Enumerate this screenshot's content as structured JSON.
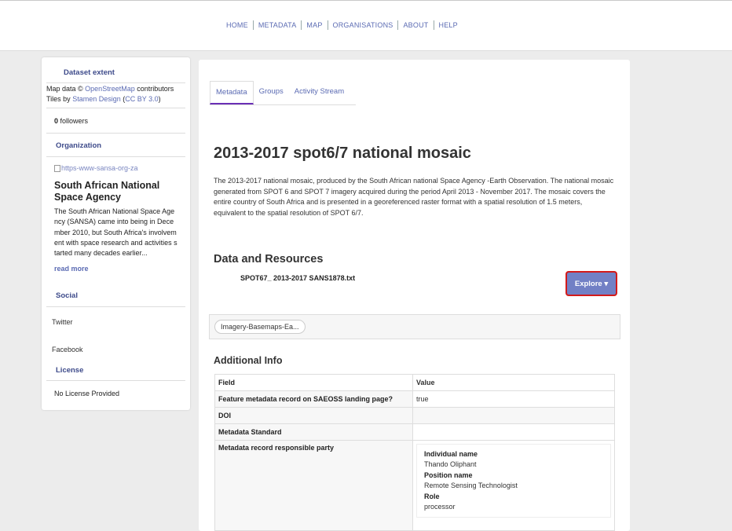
{
  "nav": [
    "HOME",
    "METADATA",
    "MAP",
    "ORGANISATIONS",
    "ABOUT",
    "HELP"
  ],
  "sidebar": {
    "dataset_extent_heading": "Dataset extent",
    "map_credit": {
      "prefix": "Map data © ",
      "osm_link": "OpenStreetMap",
      "suffix": " contributors",
      "tiles_prefix": "Tiles by ",
      "stamen_link": "Stamen Design",
      "paren_open": " (",
      "cc_link": "CC BY 3.0",
      "paren_close": ")"
    },
    "followers_count": "0",
    "followers_label": " followers",
    "organization_heading": "Organization",
    "org_image_alt": "https-www-sansa-org-za",
    "org_name": "South African National Space Agency",
    "org_description": "The South African National Space Agency (SANSA) came into being in December 2010, but South Africa's involvement with space research and activities started many decades earlier...",
    "read_more": "read more",
    "social_heading": "Social",
    "social_links": [
      "Twitter",
      "Facebook"
    ],
    "license_heading": "License",
    "license_value": "No License Provided"
  },
  "tabs": [
    "Metadata",
    "Groups",
    "Activity Stream"
  ],
  "dataset": {
    "title": "2013-2017 spot6/7 national mosaic",
    "description": "The 2013-2017 national mosaic, produced by the South African national Space Agency -Earth Observation. The national mosaic generated from SPOT 6 and SPOT 7 imagery acquired during the period April 2013 - November 2017. The mosaic covers the entire country of South Africa and is presented in a georeferenced raster format with a spatial resolution of 1.5 meters, equivalent to the spatial resolution of SPOT 6/7.",
    "resources_heading": "Data and Resources",
    "resource_name": "SPOT67_ 2013-2017 SANS1878.txt",
    "explore_label": "Explore ▾",
    "tag": "Imagery-Basemaps-Ea...",
    "additional_heading": "Additional Info"
  },
  "info_table": {
    "headers": [
      "Field",
      "Value"
    ],
    "rows": [
      {
        "field": "Feature metadata record on SAEOSS landing page?",
        "value": "true"
      },
      {
        "field": "DOI",
        "value": ""
      },
      {
        "field": "Metadata Standard",
        "value": ""
      },
      {
        "field": "Metadata record responsible party",
        "value": ""
      }
    ],
    "party": {
      "individual_label": "Individual name",
      "individual_value": "Thando Oliphant",
      "position_label": "Position name",
      "position_value": "Remote Sensing Technologist",
      "role_label": "Role",
      "role_value": "processor"
    }
  },
  "colors": {
    "accent": "#5b6bb3",
    "explore_button": "#7280c5",
    "highlight": "#d31a1a"
  }
}
